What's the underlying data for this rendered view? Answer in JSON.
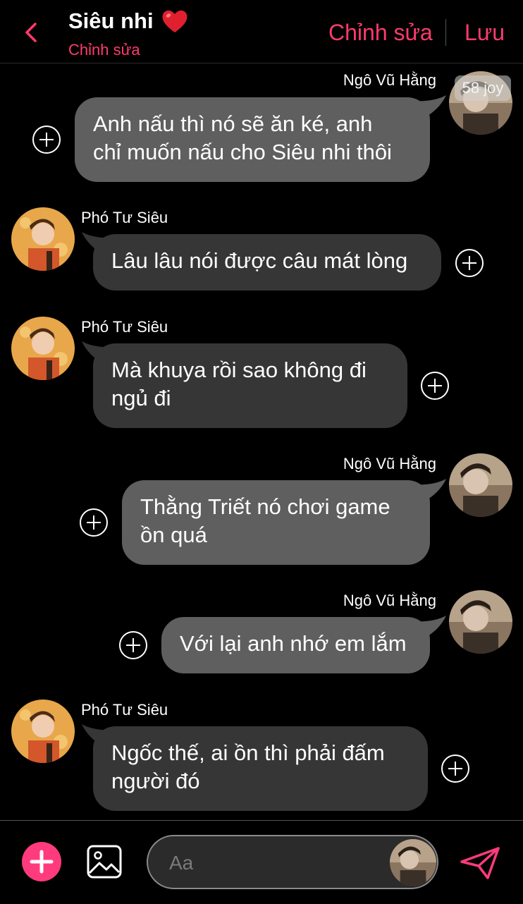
{
  "header": {
    "title": "Siêu nhi",
    "subtitle": "Chỉnh sửa",
    "edit_label": "Chỉnh sửa",
    "save_label": "Lưu",
    "accent_color": "#ff3b6b"
  },
  "badge": "58 joy",
  "messages": [
    {
      "sender": "Ngô Vũ Hằng",
      "side": "right",
      "lines": [
        "Anh nấu thì nó sẽ ăn ké, anh",
        "chỉ muốn nấu cho Siêu nhi thôi"
      ]
    },
    {
      "sender": "Phó Tư Siêu",
      "side": "left",
      "lines": [
        "Lâu lâu nói được câu mát lòng"
      ]
    },
    {
      "sender": "Phó Tư Siêu",
      "side": "left",
      "lines": [
        "Mà khuya rồi sao không đi",
        "ngủ đi"
      ]
    },
    {
      "sender": "Ngô Vũ Hằng",
      "side": "right",
      "lines": [
        "Thằng Triết nó chơi game",
        "ồn quá"
      ]
    },
    {
      "sender": "Ngô Vũ Hằng",
      "side": "right",
      "lines": [
        "Với lại anh nhớ em lắm"
      ]
    },
    {
      "sender": "Phó Tư Siêu",
      "side": "left",
      "lines": [
        "Ngốc thế, ai ồn thì phải đấm",
        "người đó"
      ]
    }
  ],
  "composer": {
    "placeholder": "Aa"
  },
  "icons": {
    "back": "chevron-left-icon",
    "title": "heart-icon",
    "react": "plus-circle-icon",
    "add": "plus-icon",
    "image": "image-icon",
    "send": "send-icon"
  }
}
